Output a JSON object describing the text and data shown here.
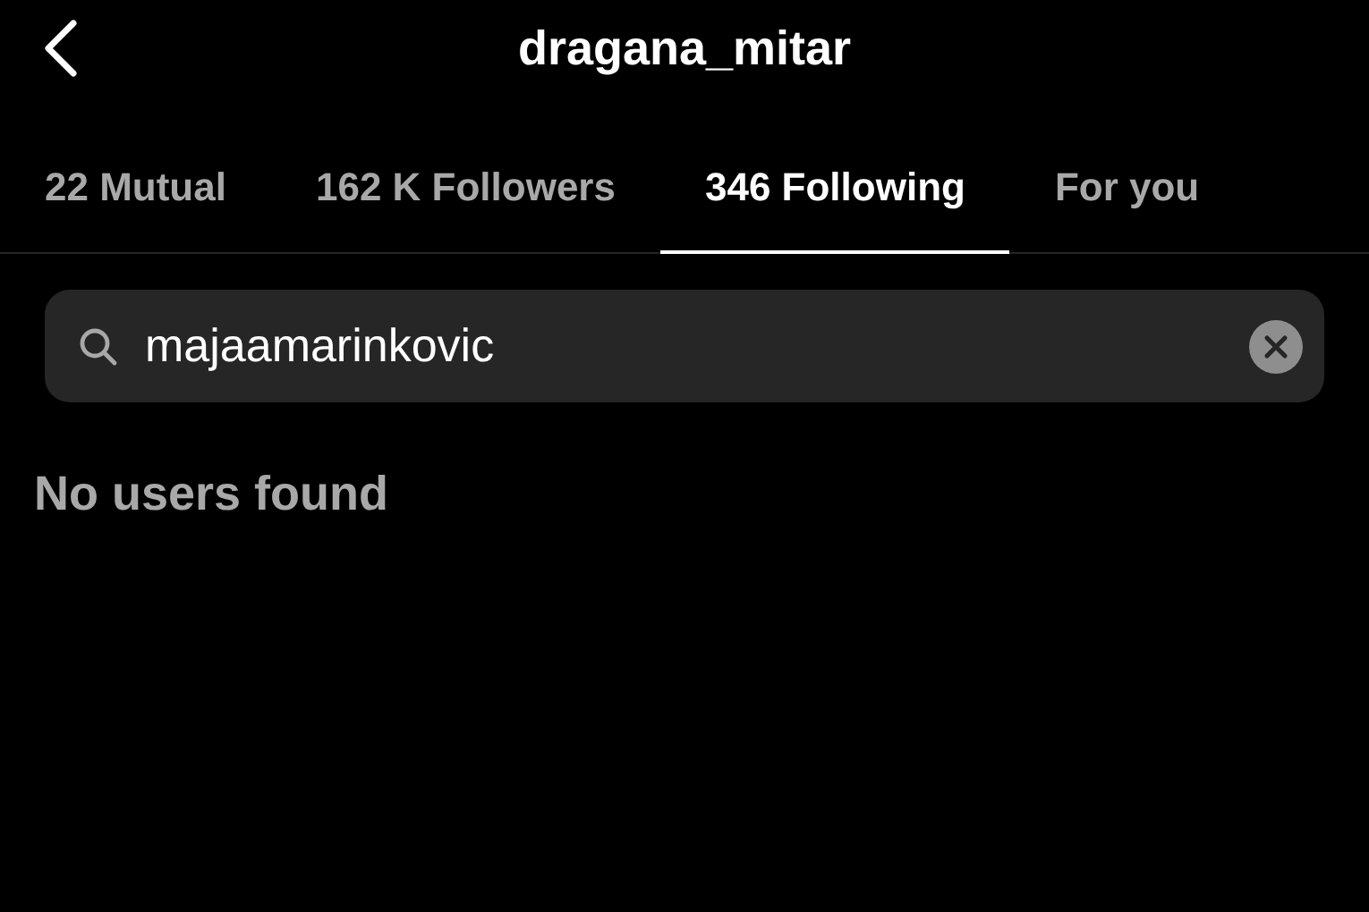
{
  "header": {
    "title": "dragana_mitar"
  },
  "tabs": [
    {
      "label": "22 Mutual",
      "selected": false
    },
    {
      "label": "162 K Followers",
      "selected": false
    },
    {
      "label": "346 Following",
      "selected": true
    },
    {
      "label": "For you",
      "selected": false
    }
  ],
  "search": {
    "value": "majaamarinkovic"
  },
  "message": "No users found"
}
